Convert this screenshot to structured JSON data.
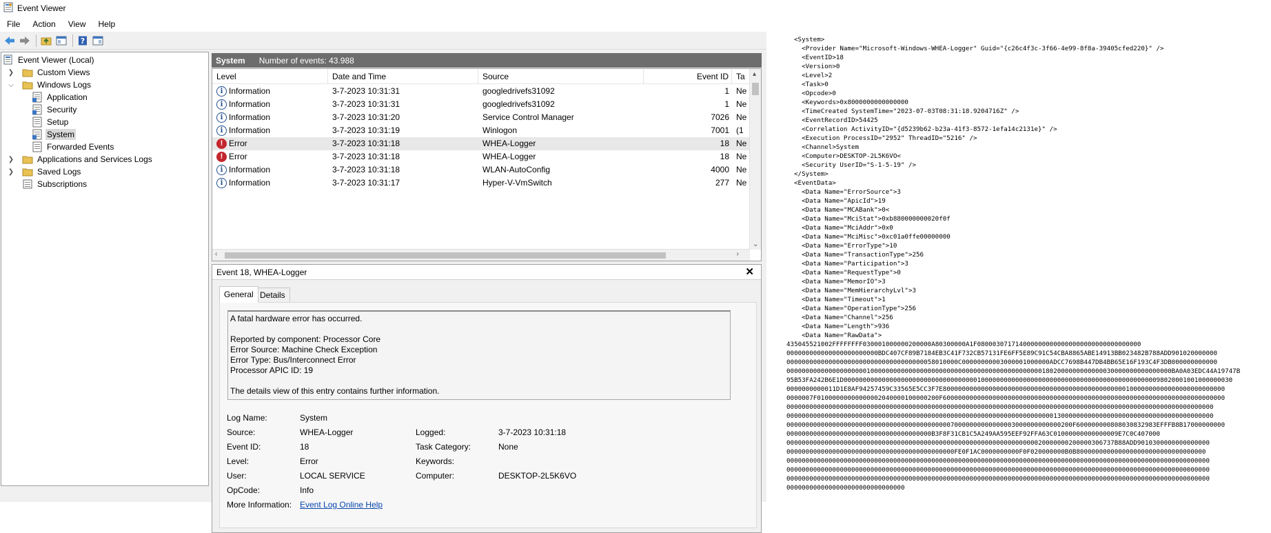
{
  "window": {
    "title": "Event Viewer"
  },
  "menu": [
    "File",
    "Action",
    "View",
    "Help"
  ],
  "toolbar_icons": [
    "back-icon",
    "forward-icon",
    "folder-up-icon",
    "show-hide-tree-icon",
    "help-icon",
    "show-hide-action-pane-icon"
  ],
  "tree": {
    "root": "Event Viewer (Local)",
    "custom_views": "Custom Views",
    "windows_logs": "Windows Logs",
    "application": "Application",
    "security": "Security",
    "setup": "Setup",
    "system": "System",
    "forwarded_events": "Forwarded Events",
    "apps_services": "Applications and Services Logs",
    "saved_logs": "Saved Logs",
    "subscriptions": "Subscriptions"
  },
  "list": {
    "log_name": "System",
    "count_text": "Number of events: 43.988",
    "columns": {
      "level": "Level",
      "date": "Date and Time",
      "source": "Source",
      "event_id": "Event ID",
      "task": "Ta"
    },
    "rows": [
      {
        "level": "Information",
        "date": "3-7-2023 10:31:31",
        "source": "googledrivefs31092",
        "id": "1",
        "task": "Ne"
      },
      {
        "level": "Information",
        "date": "3-7-2023 10:31:31",
        "source": "googledrivefs31092",
        "id": "1",
        "task": "Ne"
      },
      {
        "level": "Information",
        "date": "3-7-2023 10:31:20",
        "source": "Service Control Manager",
        "id": "7026",
        "task": "Ne"
      },
      {
        "level": "Information",
        "date": "3-7-2023 10:31:19",
        "source": "Winlogon",
        "id": "7001",
        "task": "(1"
      },
      {
        "level": "Error",
        "date": "3-7-2023 10:31:18",
        "source": "WHEA-Logger",
        "id": "18",
        "task": "Ne"
      },
      {
        "level": "Error",
        "date": "3-7-2023 10:31:18",
        "source": "WHEA-Logger",
        "id": "18",
        "task": "Ne"
      },
      {
        "level": "Information",
        "date": "3-7-2023 10:31:18",
        "source": "WLAN-AutoConfig",
        "id": "4000",
        "task": "Ne"
      },
      {
        "level": "Information",
        "date": "3-7-2023 10:31:17",
        "source": "Hyper-V-VmSwitch",
        "id": "277",
        "task": "Ne"
      }
    ]
  },
  "detail": {
    "title": "Event 18, WHEA-Logger",
    "tabs": [
      "General",
      "Details"
    ],
    "message": [
      "A fatal hardware error has occurred.",
      "",
      "Reported by component: Processor Core",
      "Error Source: Machine Check Exception",
      "Error Type: Bus/Interconnect Error",
      "Processor APIC ID: 19",
      "",
      "The details view of this entry contains further information."
    ],
    "props": {
      "log_name_label": "Log Name:",
      "log_name": "System",
      "source_label": "Source:",
      "source": "WHEA-Logger",
      "logged_label": "Logged:",
      "logged": "3-7-2023 10:31:18",
      "event_id_label": "Event ID:",
      "event_id": "18",
      "task_category_label": "Task Category:",
      "task_category": "None",
      "level_label": "Level:",
      "level": "Error",
      "keywords_label": "Keywords:",
      "keywords": "",
      "user_label": "User:",
      "user": "LOCAL SERVICE",
      "computer_label": "Computer:",
      "computer": "DESKTOP-2L5K6VO",
      "opcode_label": "OpCode:",
      "opcode": "Info",
      "more_info_label": "More Information:",
      "more_info_link": "Event Log Online Help"
    }
  },
  "xml_lines": [
    "<System>",
    "  <Provider Name=\"Microsoft-Windows-WHEA-Logger\" Guid=\"{c26c4f3c-3f66-4e99-8f8a-39405cfed220}\" />",
    "  <EventID>18",
    "  <Version>0",
    "  <Level>2",
    "  <Task>0",
    "  <Opcode>0",
    "  <Keywords>0x8000000000000000",
    "  <TimeCreated SystemTime=\"2023-07-03T08:31:18.9204716Z\" />",
    "  <EventRecordID>54425",
    "  <Correlation ActivityID=\"{d5239b62-b23a-41f3-8572-1efa14c2131e}\" />",
    "  <Execution ProcessID=\"2952\" ThreadID=\"5216\" />",
    "  <Channel>System",
    "  <Computer>DESKTOP-2L5K6VO<",
    "  <Security UserID=\"S-1-5-19\" />",
    "</System>",
    "<EventData>",
    "  <Data Name=\"ErrorSource\">3",
    "  <Data Name=\"ApicId\">19",
    "  <Data Name=\"MCABank\">0<",
    "  <Data Name=\"MciStat\">0xb880000000020f0f",
    "  <Data Name=\"MciAddr\">0x0",
    "  <Data Name=\"MciMisc\">0xc01a0ffe00000000",
    "  <Data Name=\"ErrorType\">10",
    "  <Data Name=\"TransactionType\">256",
    "  <Data Name=\"Participation\">3",
    "  <Data Name=\"RequestType\">0",
    "  <Data Name=\"MemorIO\">3",
    "  <Data Name=\"MemHierarchyLvl\">3",
    "  <Data Name=\"Timeout\">1",
    "  <Data Name=\"OperationType\">256",
    "  <Data Name=\"Channel\">256",
    "  <Data Name=\"Length\">936",
    "  <Data Name=\"RawData\">"
  ],
  "raw_data_lines": [
    "435045521002FFFFFFFF030001000000200000A80300000A1F0800030717140000000000000000000000000000000",
    "000000000000000000000000BDC407CF89B7184EB3C41F732CB57131FE6FF5E89C91C54CBA8865ABE14913BB023482B788ADD901020000000",
    "000000000000000000000000000000000000058010000C00000000003000001000000ADCC7698B447DB4BB65E16F193C4F3DB000000000000",
    "00000000000000000000010000000000000000000000000000000000000000000001802000000000000030000000000000000BA0A03EDC44A19747B",
    "95B53FA242B6E1D000000000000000000000000000000000001000000000000000000000000000000000000000000000098020001001000000030",
    "0000000000011D1E8AF94257459C33565E5CC3F7E80000000000000000000000000000000000000000000000010000000000000000000000000",
    "0000007F01000000000000002040000100000200F60000000000000000000000000000000000000000000000000000000000000000000000000",
    "0000000000000000000000000000000000000000000000000000000000000000000000000000000000000000000000000000000000000000",
    "0000000000000000000000000000000000000000000000000000000000000000000000130000000000000000000000000000000000000000",
    "000000000000000000000000000000000000000000070000000000000003000000000000200F600000000808030832983EFFFB8B17000000000",
    "00000000000000000000000000000000000000B3F8F31CB1C5A249AA595EEF92FFA63C01000000000000009E7C0C407000",
    "00000000000000000000000000000000000000000000000000000000000000000020000000200000306737B88ADD9010300000000000000",
    "00000000000000000000000000000000000000000000FE0F1AC0000000000F0F020000000B0B8000000000000000000000000000000000",
    "000000000000000000000000000000000000000000000000000000000000000000000000000000000000000000000000000000000000000",
    "000000000000000000000000000000000000000000000000000000000000000000000000000000000000000000000000000000000000000",
    "000000000000000000000000000000000000000000000000000000000000000000000000000000000000000000000000000000000000000",
    "0000000000000000000000000000000"
  ]
}
